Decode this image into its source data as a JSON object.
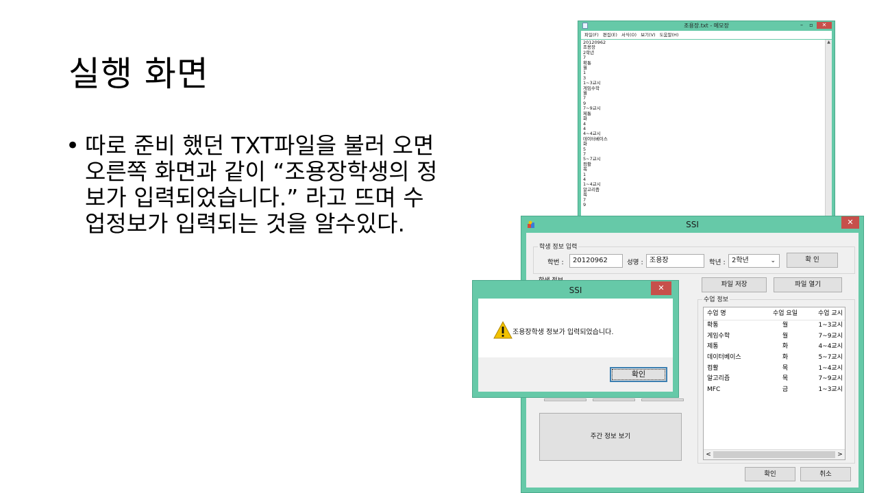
{
  "slide": {
    "title": "실행 화면",
    "bullet": "따로 준비 했던 TXT파일을 불러 오면\n오른쪽 화면과 같이 “조용장학생의 정\n보가 입력되었습니다.” 라고 뜨며 수\n업정보가 입력되는 것을 알수있다."
  },
  "notepad": {
    "title": "조용장.txt - 메모장",
    "menu": [
      "파일(F)",
      "편집(E)",
      "서식(O)",
      "보기(V)",
      "도움말(H)"
    ],
    "lines": [
      "20120962",
      "조용장",
      "2학년",
      "7",
      "확통",
      "월",
      "1",
      "3",
      "1~3교시",
      "게임수학",
      "월",
      "7",
      "9",
      "7~9교시",
      "제통",
      "화",
      "4",
      "4",
      "4~4교시",
      "데이터베이스",
      "화",
      "5",
      "7",
      "5~7교시",
      "컴활",
      "목",
      "1",
      "4",
      "1~4교시",
      "알고리즘",
      "목",
      "7",
      "9"
    ]
  },
  "ssi": {
    "title": "SSI",
    "student_group": "학생 정보 입력",
    "id_label": "학번 :",
    "id_value": "20120962",
    "name_label": "성명 :",
    "name_value": "조용장",
    "grade_label": "학년 :",
    "grade_value": "2학년",
    "confirm_top": "확 인",
    "partial_group": "학생 정보",
    "save_file": "파일 저장",
    "open_file": "파일 열기",
    "class_group": "수업 정보",
    "columns": [
      "수업 명",
      "수업 요일",
      "수업 교시"
    ],
    "rows": [
      [
        "확통",
        "월",
        "1~3교시"
      ],
      [
        "게임수학",
        "월",
        "7~9교시"
      ],
      [
        "제통",
        "화",
        "4~4교시"
      ],
      [
        "데이터베이스",
        "화",
        "5~7교시"
      ],
      [
        "컴활",
        "목",
        "1~4교시"
      ],
      [
        "알고리즘",
        "목",
        "7~9교시"
      ],
      [
        "MFC",
        "금",
        "1~3교시"
      ]
    ],
    "weekly_button": "주간 정보 보기",
    "ok": "확인",
    "cancel": "취소"
  },
  "msgbox": {
    "title": "SSI",
    "message": "조용장학생 정보가 입력되었습니다.",
    "ok": "확인"
  },
  "colors": {
    "window_frame": "#66c9a8",
    "close_button": "#c7504b",
    "warning": "#f2c200"
  }
}
